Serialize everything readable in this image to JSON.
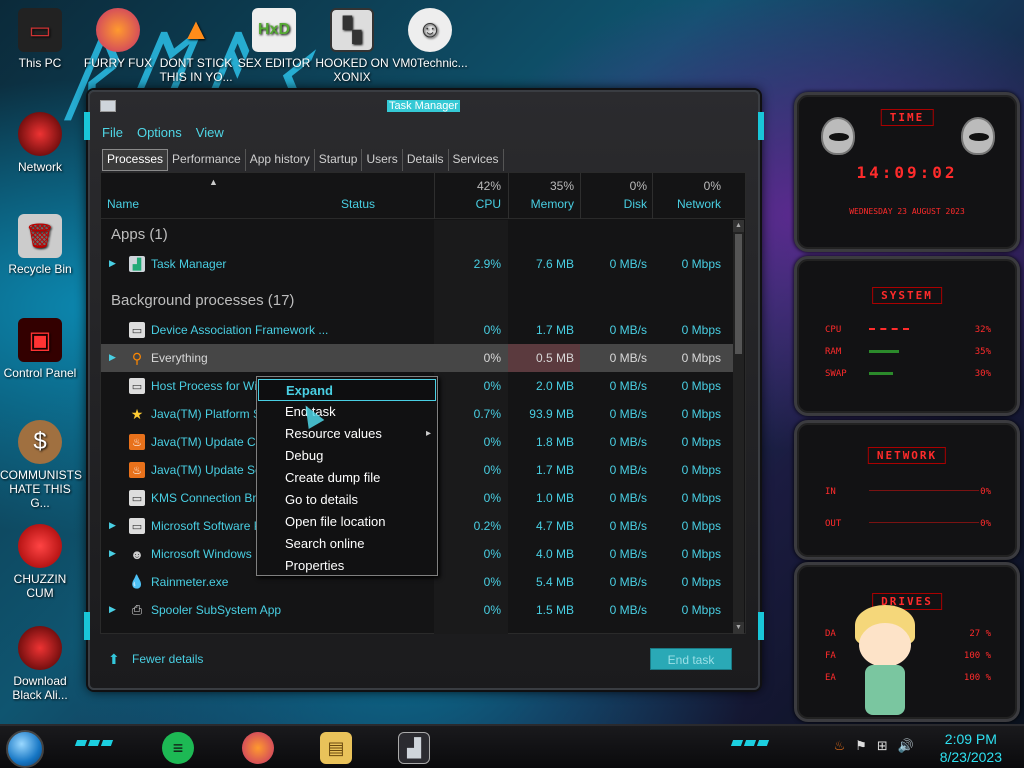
{
  "desktop": {
    "icons": [
      {
        "label": "This PC"
      },
      {
        "label": "FURRY FUX"
      },
      {
        "label": "DONT STICK THIS IN YO..."
      },
      {
        "label": "SEX EDITOR"
      },
      {
        "label": "HOOKED ON XONIX"
      },
      {
        "label": "VM0Technic..."
      },
      {
        "label": "Network"
      },
      {
        "label": "Recycle Bin"
      },
      {
        "label": "Control Panel"
      },
      {
        "label": "COMMUNISTS HATE THIS G..."
      },
      {
        "label": "CHUZZIN CUM"
      },
      {
        "label": "Download Black Ali..."
      }
    ]
  },
  "task_manager": {
    "title": "Task Manager",
    "menu": [
      "File",
      "Options",
      "View"
    ],
    "tabs": [
      "Processes",
      "Performance",
      "App history",
      "Startup",
      "Users",
      "Details",
      "Services"
    ],
    "columns": {
      "name": "Name",
      "status": "Status",
      "cpu": {
        "label": "CPU",
        "pct": "42%"
      },
      "memory": {
        "label": "Memory",
        "pct": "35%"
      },
      "disk": {
        "label": "Disk",
        "pct": "0%"
      },
      "network": {
        "label": "Network",
        "pct": "0%"
      }
    },
    "groups": {
      "apps": "Apps (1)",
      "background": "Background processes (17)"
    },
    "rows": [
      {
        "name": "Task Manager",
        "cpu": "2.9%",
        "mem": "7.6 MB",
        "disk": "0 MB/s",
        "net": "0 Mbps"
      },
      {
        "name": "Device Association Framework ...",
        "cpu": "0%",
        "mem": "1.7 MB",
        "disk": "0 MB/s",
        "net": "0 Mbps"
      },
      {
        "name": "Everything",
        "cpu": "0%",
        "mem": "0.5 MB",
        "disk": "0 MB/s",
        "net": "0 Mbps"
      },
      {
        "name": "Host Process for Wir",
        "cpu": "0%",
        "mem": "2.0 MB",
        "disk": "0 MB/s",
        "net": "0 Mbps"
      },
      {
        "name": "Java(TM) Platform S",
        "cpu": "0.7%",
        "mem": "93.9 MB",
        "disk": "0 MB/s",
        "net": "0 Mbps"
      },
      {
        "name": "Java(TM) Update Ch",
        "cpu": "0%",
        "mem": "1.8 MB",
        "disk": "0 MB/s",
        "net": "0 Mbps"
      },
      {
        "name": "Java(TM) Update Sc",
        "cpu": "0%",
        "mem": "1.7 MB",
        "disk": "0 MB/s",
        "net": "0 Mbps"
      },
      {
        "name": "KMS Connection Bro",
        "cpu": "0%",
        "mem": "1.0 MB",
        "disk": "0 MB/s",
        "net": "0 Mbps"
      },
      {
        "name": "Microsoft Software P",
        "cpu": "0.2%",
        "mem": "4.7 MB",
        "disk": "0 MB/s",
        "net": "0 Mbps"
      },
      {
        "name": "Microsoft Windows",
        "cpu": "0%",
        "mem": "4.0 MB",
        "disk": "0 MB/s",
        "net": "0 Mbps"
      },
      {
        "name": "Rainmeter.exe",
        "cpu": "0%",
        "mem": "5.4 MB",
        "disk": "0 MB/s",
        "net": "0 Mbps"
      },
      {
        "name": "Spooler SubSystem App",
        "cpu": "0%",
        "mem": "1.5 MB",
        "disk": "0 MB/s",
        "net": "0 Mbps"
      }
    ],
    "fewer_details": "Fewer details",
    "end_task": "End task"
  },
  "context_menu": {
    "items": [
      "Expand",
      "End task",
      "Resource values",
      "Debug",
      "Create dump file",
      "Go to details",
      "Open file location",
      "Search online",
      "Properties"
    ]
  },
  "gadgets": {
    "time_tag": "TIME",
    "time": "14:09:02",
    "date": "WEDNESDAY 23 AUGUST 2023",
    "system_tag": "SYSTEM",
    "cpu_label": "CPU",
    "cpu_val": "32%",
    "ram_label": "RAM",
    "ram_val": "35%",
    "swap_label": "SWAP",
    "swap_val": "30%",
    "network_tag": "NETWORK",
    "in_label": "IN",
    "in_val": "0%",
    "out_label": "OUT",
    "out_val": "0%",
    "drives_tag": "DRIVES",
    "drives": [
      {
        "label": "DA",
        "val": "27 %"
      },
      {
        "label": "FA",
        "val": "100 %"
      },
      {
        "label": "EA",
        "val": "100 %"
      }
    ]
  },
  "taskbar": {
    "time": "2:09 PM",
    "date": "8/23/2023"
  },
  "colors": {
    "accent": "#49cfe3",
    "gadget_red": "#ff2b2b"
  }
}
